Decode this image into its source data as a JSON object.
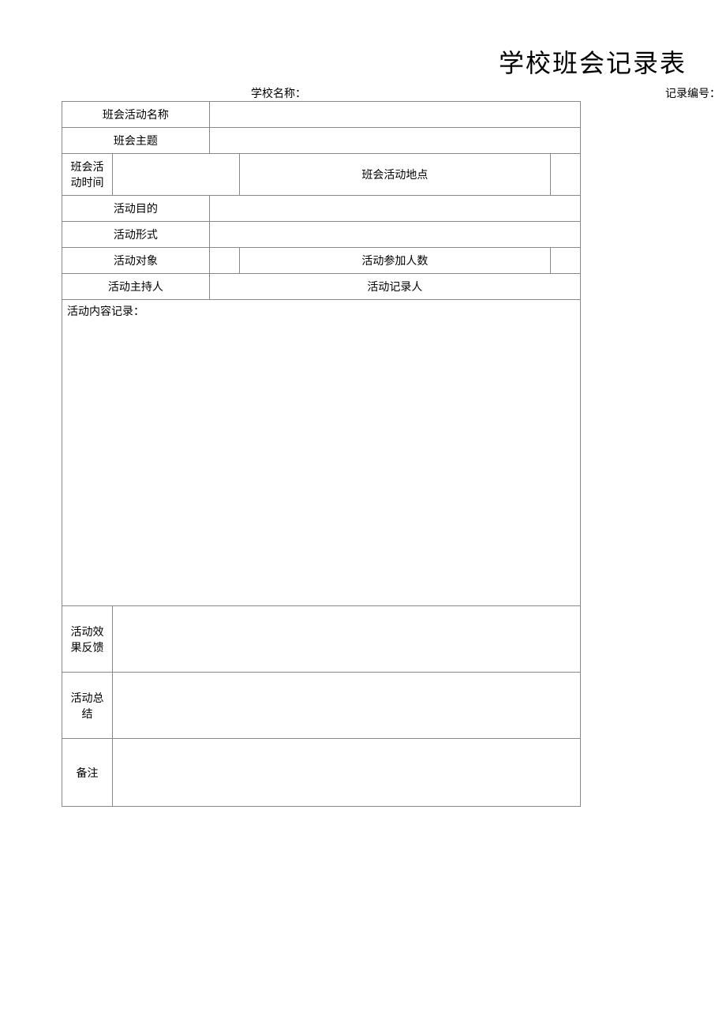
{
  "title": "学校班会记录表",
  "header": {
    "school_name_label": "学校名称：",
    "record_no_label": "记录编号："
  },
  "rows": {
    "activity_name": {
      "label": "班会活动名称",
      "value": ""
    },
    "theme": {
      "label": "班会主题",
      "value": ""
    },
    "activity_time": {
      "label": "班会活动时间",
      "value": ""
    },
    "activity_location": {
      "label": "班会活动地点",
      "value": ""
    },
    "activity_purpose": {
      "label": "活动目的",
      "value": ""
    },
    "activity_format": {
      "label": "活动形式",
      "value": ""
    },
    "activity_target": {
      "label": "活动对象",
      "value": ""
    },
    "participant_count": {
      "label": "活动参加人数",
      "value": ""
    },
    "host": {
      "label": "活动主持人",
      "value": ""
    },
    "recorder": {
      "label": "活动记录人",
      "value": ""
    },
    "content_record": {
      "label": "活动内容记录：",
      "value": ""
    },
    "effect_feedback": {
      "label": "活动效果反馈",
      "value": ""
    },
    "summary": {
      "label": "活动总结",
      "value": ""
    },
    "remark": {
      "label": "备注",
      "value": ""
    }
  }
}
